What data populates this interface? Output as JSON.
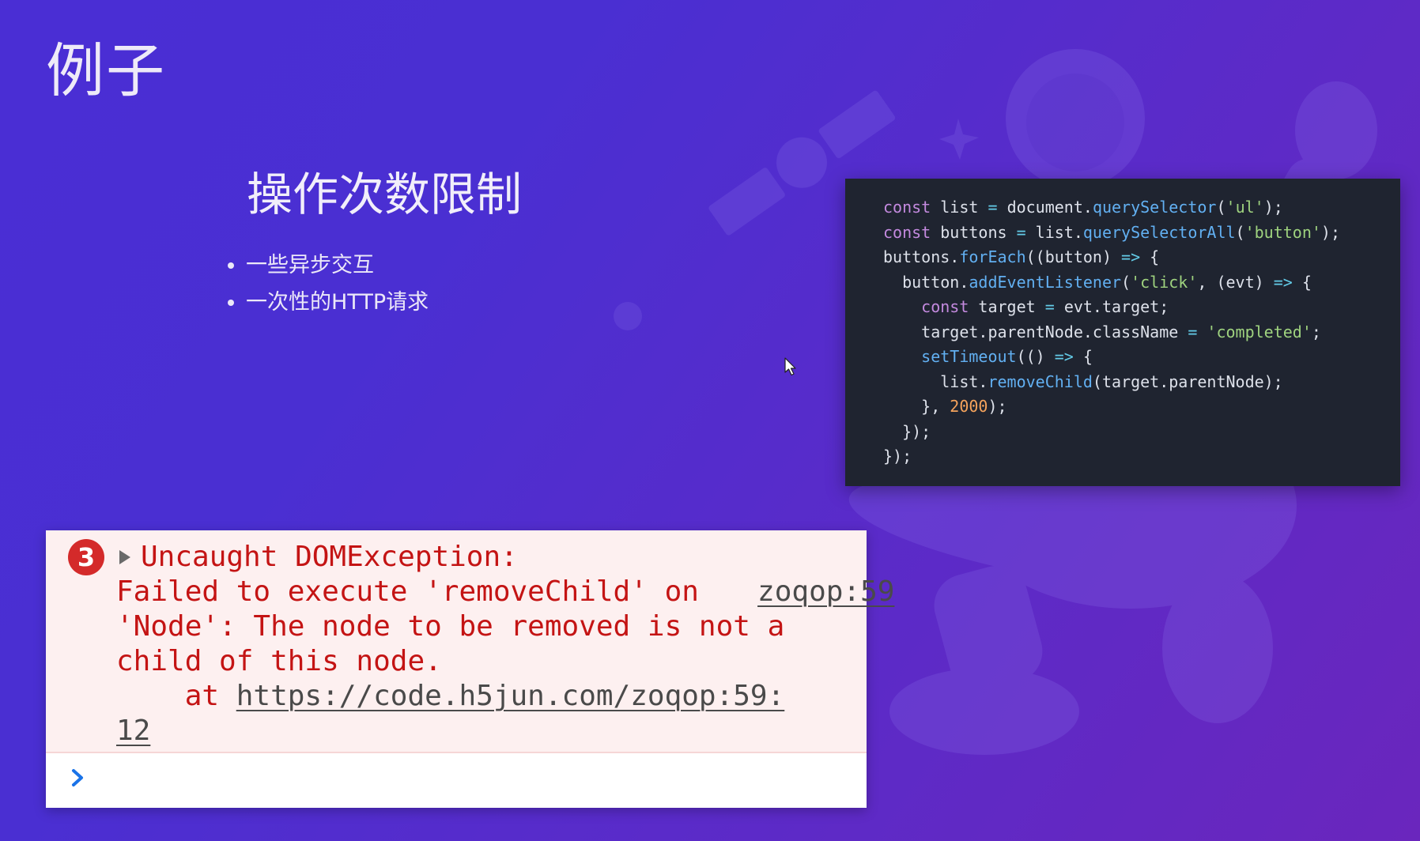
{
  "slide": {
    "title": "例子",
    "subtitle": "操作次数限制",
    "bullets": [
      "一些异步交互",
      "一次性的HTTP请求"
    ]
  },
  "code": {
    "lines": [
      [
        [
          "kw",
          "const "
        ],
        [
          "plain",
          "list "
        ],
        [
          "op",
          "= "
        ],
        [
          "plain",
          "document."
        ],
        [
          "fn",
          "querySelector"
        ],
        [
          "plain",
          "("
        ],
        [
          "str",
          "'ul'"
        ],
        [
          "plain",
          ");"
        ]
      ],
      [
        [
          "kw",
          "const "
        ],
        [
          "plain",
          "buttons "
        ],
        [
          "op",
          "= "
        ],
        [
          "plain",
          "list."
        ],
        [
          "fn",
          "querySelectorAll"
        ],
        [
          "plain",
          "("
        ],
        [
          "str",
          "'button'"
        ],
        [
          "plain",
          ");"
        ]
      ],
      [
        [
          "plain",
          "buttons."
        ],
        [
          "fn",
          "forEach"
        ],
        [
          "plain",
          "((button) "
        ],
        [
          "op",
          "=> "
        ],
        [
          "plain",
          "{"
        ]
      ],
      [
        [
          "plain",
          "  button."
        ],
        [
          "fn",
          "addEventListener"
        ],
        [
          "plain",
          "("
        ],
        [
          "str",
          "'click'"
        ],
        [
          "plain",
          ", (evt) "
        ],
        [
          "op",
          "=> "
        ],
        [
          "plain",
          "{"
        ]
      ],
      [
        [
          "kw",
          "    const "
        ],
        [
          "plain",
          "target "
        ],
        [
          "op",
          "= "
        ],
        [
          "plain",
          "evt.target;"
        ]
      ],
      [
        [
          "plain",
          "    target.parentNode.className "
        ],
        [
          "op",
          "= "
        ],
        [
          "str",
          "'completed'"
        ],
        [
          "plain",
          ";"
        ]
      ],
      [
        [
          "fn",
          "    setTimeout"
        ],
        [
          "plain",
          "(() "
        ],
        [
          "op",
          "=> "
        ],
        [
          "plain",
          "{"
        ]
      ],
      [
        [
          "plain",
          "      list."
        ],
        [
          "fn",
          "removeChild"
        ],
        [
          "plain",
          "(target.parentNode);"
        ]
      ],
      [
        [
          "plain",
          "    }, "
        ],
        [
          "num",
          "2000"
        ],
        [
          "plain",
          ");"
        ]
      ],
      [
        [
          "plain",
          "  });"
        ]
      ],
      [
        [
          "plain",
          "});"
        ]
      ]
    ]
  },
  "console": {
    "error_count": "3",
    "header_text": "Uncaught DOMException:",
    "source_link": "zoqop:59",
    "message_line1": "Failed to execute 'removeChild' on",
    "message_line2": "'Node': The node to be removed is not a",
    "message_line3": "child of this node.",
    "at_prefix": "    at ",
    "stack_link_part1": "https://code.h5jun.com/zoqop:59:",
    "stack_link_part2": "12"
  },
  "colors": {
    "background_start": "#4a2ed4",
    "background_end": "#6a26bd",
    "code_bg": "#1f2430",
    "error_text": "#c41414",
    "error_bg": "#fdf0f0",
    "error_badge": "#d42a2a",
    "prompt": "#1a73e8"
  },
  "icons": {
    "error_badge": "error-count-badge",
    "expand": "triangle-right-icon",
    "prompt": "chevron-right-icon",
    "cursor": "mouse-pointer-icon"
  }
}
